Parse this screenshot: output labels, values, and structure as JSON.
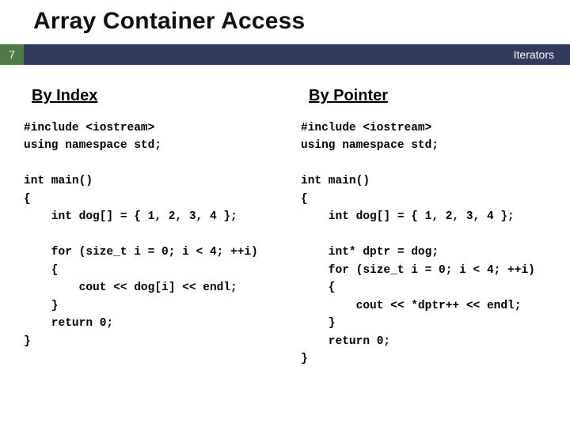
{
  "title": "Array Container Access",
  "bar": {
    "number": "7",
    "label": "Iterators"
  },
  "left": {
    "heading": "By Index",
    "code": "#include <iostream>\nusing namespace std;\n\nint main()\n{\n    int dog[] = { 1, 2, 3, 4 };\n\n    for (size_t i = 0; i < 4; ++i)\n    {\n        cout << dog[i] << endl;\n    }\n    return 0;\n}"
  },
  "right": {
    "heading": "By Pointer",
    "code": "#include <iostream>\nusing namespace std;\n\nint main()\n{\n    int dog[] = { 1, 2, 3, 4 };\n\n    int* dptr = dog;\n    for (size_t i = 0; i < 4; ++i)\n    {\n        cout << *dptr++ << endl;\n    }\n    return 0;\n}"
  }
}
